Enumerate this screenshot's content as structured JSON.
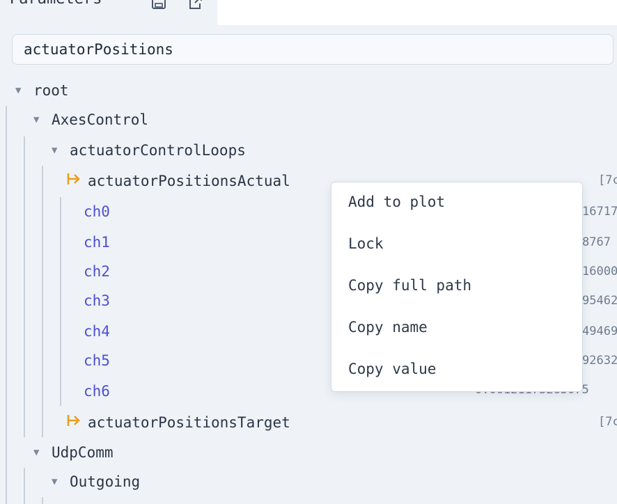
{
  "panel": {
    "title": "Parameters",
    "save_icon": "save-icon",
    "export_icon": "external-link-icon"
  },
  "search": {
    "value": "actuatorPositions",
    "placeholder": ""
  },
  "tree": {
    "root": "root",
    "axes_control": "AxesControl",
    "actuator_control_loops": "actuatorControlLoops",
    "positions_actual": {
      "label": "actuatorPositionsActual",
      "value": "[7c"
    },
    "channels": [
      {
        "label": "ch0",
        "value": "16717"
      },
      {
        "label": "ch1",
        "value": "8767"
      },
      {
        "label": "ch2",
        "value": "16000"
      },
      {
        "label": "ch3",
        "value": "95462"
      },
      {
        "label": "ch4",
        "value": "49469"
      },
      {
        "label": "ch5",
        "value": "92632"
      },
      {
        "label": "ch6",
        "value": "0.06121173265075"
      }
    ],
    "positions_target": {
      "label": "actuatorPositionsTarget",
      "value": "[7c"
    },
    "udp_comm": "UdpComm",
    "outgoing": "Outgoing"
  },
  "context_menu": {
    "items": [
      "Add to plot",
      "Lock",
      "Copy full path",
      "Copy name",
      "Copy value"
    ]
  },
  "colors": {
    "accent": "#e8a020",
    "leaf_text": "#4d4fd0",
    "background": "#eff3f8"
  }
}
